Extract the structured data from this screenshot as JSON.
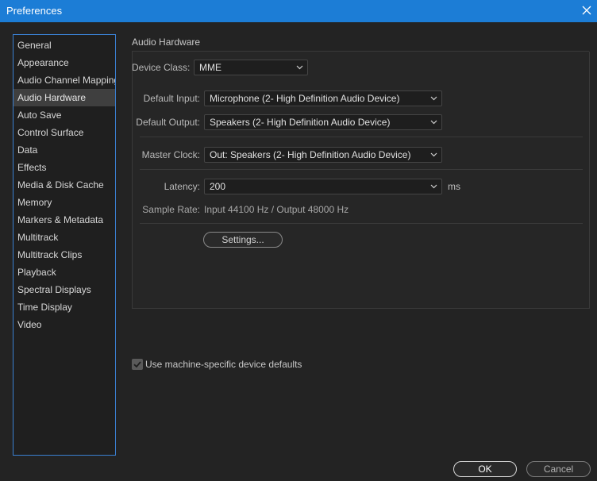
{
  "window": {
    "title": "Preferences",
    "close_icon": "close-icon"
  },
  "sidebar": {
    "items": [
      {
        "label": "General"
      },
      {
        "label": "Appearance"
      },
      {
        "label": "Audio Channel Mapping"
      },
      {
        "label": "Audio Hardware",
        "selected": true
      },
      {
        "label": "Auto Save"
      },
      {
        "label": "Control Surface"
      },
      {
        "label": "Data"
      },
      {
        "label": "Effects"
      },
      {
        "label": "Media & Disk Cache"
      },
      {
        "label": "Memory"
      },
      {
        "label": "Markers & Metadata"
      },
      {
        "label": "Multitrack"
      },
      {
        "label": "Multitrack Clips"
      },
      {
        "label": "Playback"
      },
      {
        "label": "Spectral Displays"
      },
      {
        "label": "Time Display"
      },
      {
        "label": "Video"
      }
    ]
  },
  "main": {
    "section_title": "Audio Hardware",
    "device_class": {
      "label": "Device Class:",
      "value": "MME"
    },
    "default_input": {
      "label": "Default Input:",
      "value": "Microphone (2- High Definition Audio Device)"
    },
    "default_output": {
      "label": "Default Output:",
      "value": "Speakers (2- High Definition Audio Device)"
    },
    "master_clock": {
      "label": "Master Clock:",
      "value": "Out: Speakers (2- High Definition Audio Device)"
    },
    "latency": {
      "label": "Latency:",
      "value": "200",
      "unit": "ms"
    },
    "sample_rate": {
      "label": "Sample Rate:",
      "value": "Input 44100 Hz / Output 48000 Hz"
    },
    "settings_button": "Settings..."
  },
  "machine_defaults": {
    "label": "Use machine-specific device defaults",
    "checked": true
  },
  "footer": {
    "ok_label": "OK",
    "cancel_label": "Cancel"
  },
  "colors": {
    "titlebar": "#1c7dd6",
    "background": "#232323",
    "sidebar_border": "#3a7fd1"
  }
}
